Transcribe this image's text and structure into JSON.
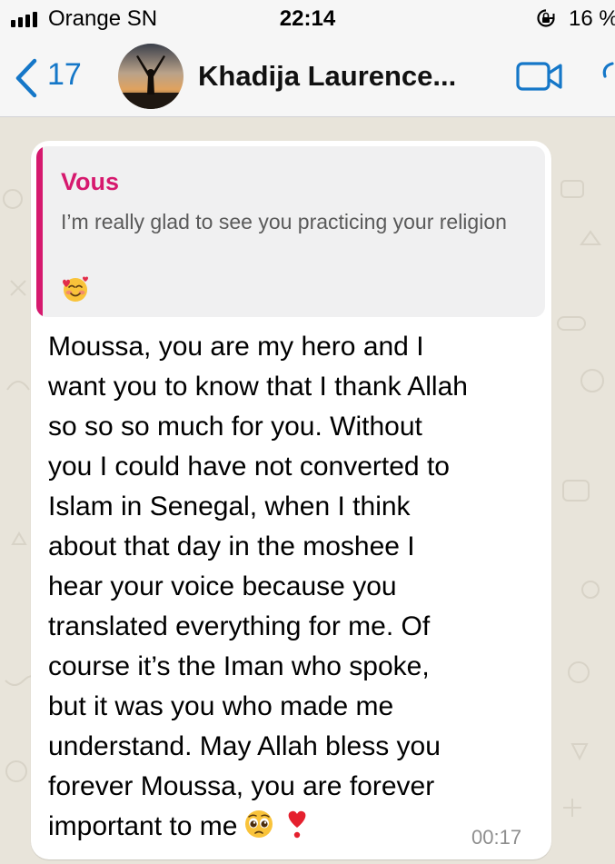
{
  "status_bar": {
    "carrier": "Orange SN",
    "time": "22:14",
    "battery_percent": "16 %"
  },
  "header": {
    "back_count": "17",
    "contact_name": "Khadija Laurence..."
  },
  "message": {
    "quoted_author": "Vous",
    "quoted_text": "I’m really glad to see you practicing your religion",
    "quoted_emoji": "smiling-face-with-hearts",
    "lines": [
      "Moussa, you are my hero and I",
      "want you to know that I thank Allah",
      "so so so much for you. Without",
      "you I could have not converted to",
      "Islam in Senegal, when I think",
      "about that day in the moshee I",
      "hear your voice because you",
      "translated everything for me. Of",
      "course it’s the Iman who spoke,",
      "but it was you who made me",
      "understand. May Allah bless you",
      "forever Moussa, you are forever",
      "important to me"
    ],
    "trailing_emojis": [
      "pleading-face",
      "heavy-heart-exclamation"
    ],
    "time": "00:17"
  },
  "colors": {
    "accent_blue": "#1577c8",
    "quote_pink": "#d6196e",
    "chat_wallpaper": "#e8e4da",
    "bubble": "#ffffff"
  }
}
